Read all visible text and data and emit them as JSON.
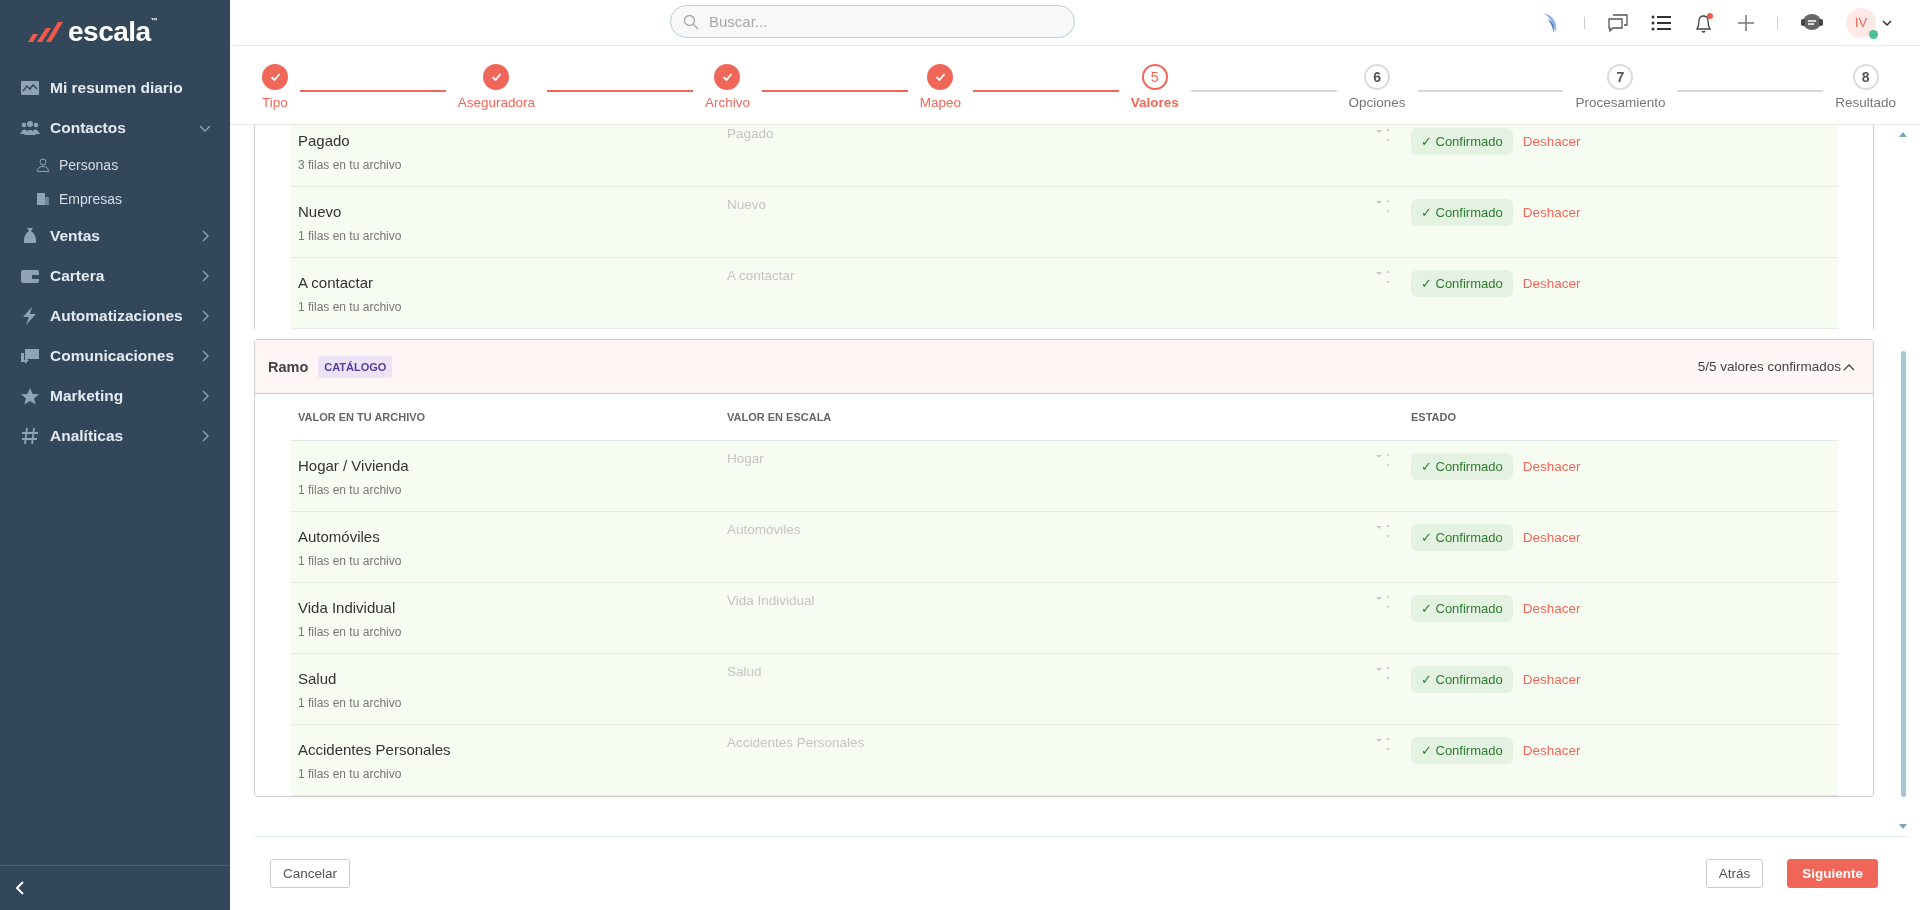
{
  "sidebar": {
    "logo": "escala",
    "logo_mark": "™",
    "items": [
      {
        "label": "Mi resumen diario"
      },
      {
        "label": "Contactos",
        "expanded": true,
        "children": [
          {
            "label": "Personas"
          },
          {
            "label": "Empresas"
          }
        ]
      },
      {
        "label": "Ventas",
        "expanded": false
      },
      {
        "label": "Cartera",
        "expanded": false
      },
      {
        "label": "Automatizaciones",
        "expanded": false
      },
      {
        "label": "Comunicaciones",
        "expanded": false
      },
      {
        "label": "Marketing",
        "expanded": false
      },
      {
        "label": "Analíticas",
        "expanded": false
      }
    ]
  },
  "topbar": {
    "search": {
      "placeholder": "Buscar..."
    },
    "avatar": "IV"
  },
  "stepper": [
    {
      "label": "Tipo",
      "completed": true,
      "selected": false
    },
    {
      "label": "Aseguradora",
      "completed": true,
      "selected": false
    },
    {
      "label": "Archivo",
      "completed": true,
      "selected": false
    },
    {
      "label": "Mapeo",
      "completed": true,
      "selected": false
    },
    {
      "number": "5",
      "label": "Valores",
      "completed": false,
      "selected": true
    },
    {
      "number": "6",
      "label": "Opciones",
      "completed": false,
      "selected": false
    },
    {
      "number": "7",
      "label": "Procesamiento",
      "completed": false,
      "selected": false
    },
    {
      "number": "8",
      "label": "Resultado",
      "completed": false,
      "selected": false
    }
  ],
  "sections": [
    {
      "rows": [
        {
          "name": "Pagado",
          "count": "3 filas en tu archivo",
          "value": "Pagado",
          "status": "✓ Confirmado",
          "action": "Deshacer"
        },
        {
          "name": "Nuevo",
          "count": "1 filas en tu archivo",
          "value": "Nuevo",
          "status": "✓ Confirmado",
          "action": "Deshacer"
        },
        {
          "name": "A contactar",
          "count": "1 filas en tu archivo",
          "value": "A contactar",
          "status": "✓ Confirmado",
          "action": "Deshacer"
        }
      ]
    },
    {
      "title": "Ramo",
      "tag": "CATÁLOGO",
      "summary": "5/5 valores confirmados",
      "expanded": true,
      "columns": [
        "VALOR EN TU ARCHIVO",
        "VALOR EN ESCALA",
        "ESTADO"
      ],
      "rows": [
        {
          "name": "Hogar / Vivienda",
          "count": "1 filas en tu archivo",
          "value": "Hogar",
          "status": "✓ Confirmado",
          "action": "Deshacer"
        },
        {
          "name": "Automóviles",
          "count": "1 filas en tu archivo",
          "value": "Automóviles",
          "status": "✓ Confirmado",
          "action": "Deshacer"
        },
        {
          "name": "Vida Individual",
          "count": "1 filas en tu archivo",
          "value": "Vida Individual",
          "status": "✓ Confirmado",
          "action": "Deshacer"
        },
        {
          "name": "Salud",
          "count": "1 filas en tu archivo",
          "value": "Salud",
          "status": "✓ Confirmado",
          "action": "Deshacer"
        },
        {
          "name": "Accidentes Personales",
          "count": "1 filas en tu archivo",
          "value": "Accidentes Personales",
          "status": "✓ Confirmado",
          "action": "Deshacer"
        }
      ]
    }
  ],
  "footer": {
    "cancel": "Cancelar",
    "back": "Atrás",
    "next": "Siguiente"
  }
}
